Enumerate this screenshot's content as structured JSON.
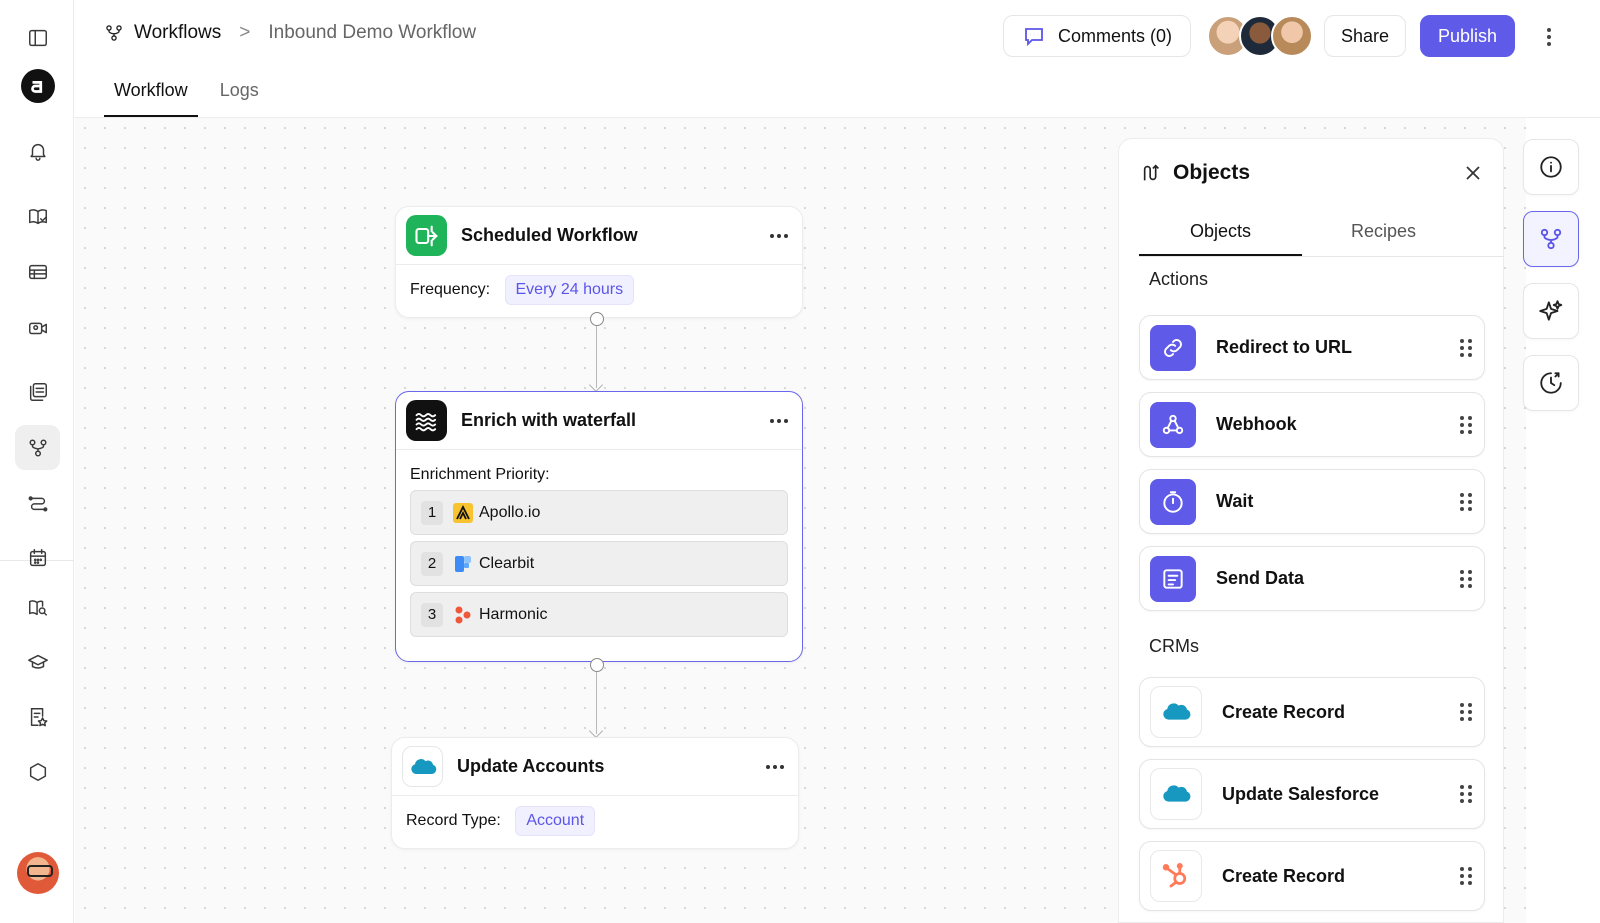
{
  "breadcrumb": {
    "root": "Workflows",
    "separator": ">",
    "current": "Inbound Demo Workflow"
  },
  "tabs": [
    {
      "label": "Workflow",
      "active": true
    },
    {
      "label": "Logs",
      "active": false
    }
  ],
  "header": {
    "comments_label": "Comments (0)",
    "share_label": "Share",
    "publish_label": "Publish"
  },
  "colors": {
    "accent": "#5f5ae8",
    "schedule_green": "#1fb35a",
    "salesforce_blue": "#1798c1",
    "hubspot_orange": "#ff7a59"
  },
  "nodes": {
    "scheduled": {
      "title": "Scheduled Workflow",
      "field_label": "Frequency:",
      "field_value": "Every 24 hours"
    },
    "enrich": {
      "title": "Enrich with waterfall",
      "field_label": "Enrichment Priority:",
      "providers": [
        {
          "rank": "1",
          "name": "Apollo.io"
        },
        {
          "rank": "2",
          "name": "Clearbit"
        },
        {
          "rank": "3",
          "name": "Harmonic"
        }
      ]
    },
    "update": {
      "title": "Update Accounts",
      "field_label": "Record Type:",
      "field_value": "Account"
    }
  },
  "panel": {
    "title": "Objects",
    "tabs": [
      {
        "label": "Objects",
        "active": true
      },
      {
        "label": "Recipes",
        "active": false
      }
    ],
    "sections": {
      "actions": {
        "label": "Actions",
        "items": [
          {
            "label": "Redirect to URL",
            "icon": "link-icon"
          },
          {
            "label": "Webhook",
            "icon": "webhook-icon"
          },
          {
            "label": "Wait",
            "icon": "timer-icon"
          },
          {
            "label": "Send Data",
            "icon": "send-data-icon"
          }
        ]
      },
      "crms": {
        "label": "CRMs",
        "items": [
          {
            "label": "Create Record",
            "icon": "salesforce-icon"
          },
          {
            "label": "Update Salesforce",
            "icon": "salesforce-icon"
          },
          {
            "label": "Create Record",
            "icon": "hubspot-icon"
          }
        ]
      }
    }
  }
}
